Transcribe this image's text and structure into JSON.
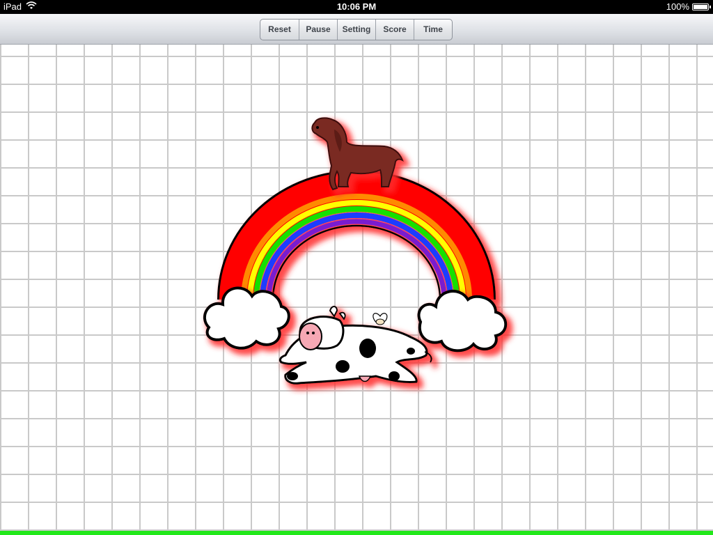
{
  "status_bar": {
    "device": "iPad",
    "wifi_icon": "wifi-icon",
    "time": "10:06 PM",
    "battery_text": "100%",
    "battery_level": 1.0
  },
  "toolbar": {
    "buttons": [
      {
        "label": "Reset"
      },
      {
        "label": "Pause"
      },
      {
        "label": "Setting"
      },
      {
        "label": "Score"
      },
      {
        "label": "Time"
      }
    ]
  },
  "board": {
    "grid_color": "#c9c9c9",
    "bottom_bar_color": "#22e81a",
    "pieces": [
      "dog",
      "rainbow",
      "cloud-left",
      "cloud-right",
      "cow",
      "winged-bird"
    ],
    "highlight_color": "#ff2a2a"
  }
}
